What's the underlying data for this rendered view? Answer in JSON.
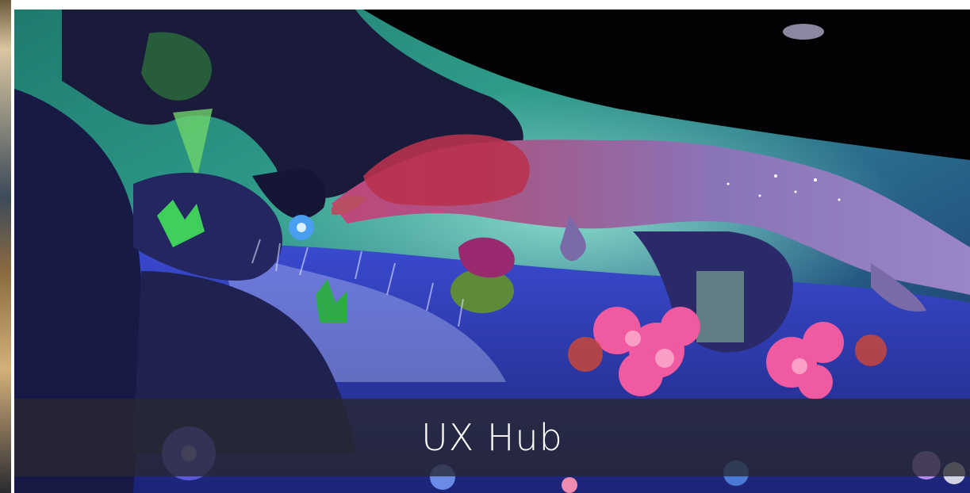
{
  "slide": {
    "caption": "UX Hub",
    "image_subject": "illustration-dragon-forest-mural"
  },
  "colors": {
    "caption_bar": "#28283080",
    "caption_text": "#ffffff"
  }
}
